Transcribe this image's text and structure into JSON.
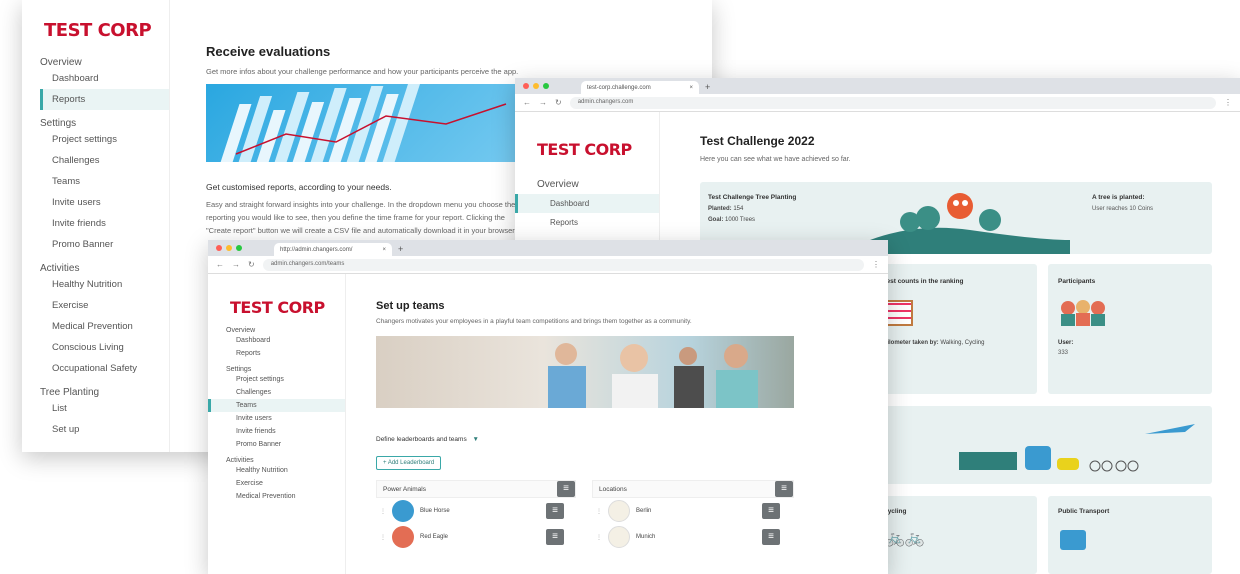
{
  "back_window": {
    "logo": "TEST CORP",
    "nav": {
      "overview": "Overview",
      "dashboard": "Dashboard",
      "reports": "Reports",
      "settings": "Settings",
      "project_settings": "Project settings",
      "challenges": "Challenges",
      "teams": "Teams",
      "invite_users": "Invite users",
      "invite_friends": "Invite friends",
      "promo_banner": "Promo Banner",
      "activities": "Activities",
      "healthy_nutrition": "Healthy Nutrition",
      "exercise": "Exercise",
      "medical_prevention": "Medical Prevention",
      "conscious_living": "Conscious Living",
      "occupational_safety": "Occupational Safety",
      "tree_planting": "Tree Planting",
      "list": "List",
      "set_up": "Set up"
    },
    "title": "Receive evaluations",
    "subtitle": "Get more infos about your challenge performance and how your participants perceive the app.",
    "section_title": "Get customised reports, according to your needs.",
    "body": "Easy and straight forward insights into your challenge. In the dropdown menu you choose the reporting you would like to see, then you define the time frame for your report. Clicking the \"Create report\" button we will create a CSV file and automatically download it in your browser."
  },
  "right_window": {
    "tab_title": "test-corp.challenge.com",
    "url": "admin.changers.com",
    "logo": "TEST CORP",
    "nav": {
      "overview": "Overview",
      "dashboard": "Dashboard",
      "reports": "Reports"
    },
    "title": "Test Challenge 2022",
    "subtitle": "Here you can see what we have achieved so far.",
    "tree_card": {
      "title": "Test Challenge Tree Planting",
      "planted_label": "Planted:",
      "planted_value": "154",
      "goal_label": "Goal:",
      "goal_value": "1000 Trees",
      "side_title": "A tree is planted:",
      "side_text": "User reaches 10 Coins"
    },
    "ranking_card": {
      "title": "Test counts in the ranking",
      "odo_label": "Kilometer taken by:",
      "odo_value": "Walking, Cycling"
    },
    "participants_card": {
      "title": "Participants",
      "users_label": "User:",
      "users_value": "333"
    },
    "cycling_card": {
      "title": "Cycling"
    },
    "transport_card": {
      "title": "Public Transport"
    }
  },
  "front_window": {
    "tab_title": "http://admin.changers.com/",
    "url": "admin.changers.com/teams",
    "logo": "TEST CORP",
    "nav": {
      "overview": "Overview",
      "dashboard": "Dashboard",
      "reports": "Reports",
      "settings": "Settings",
      "project_settings": "Project settings",
      "challenges": "Challenges",
      "teams": "Teams",
      "invite_users": "Invite users",
      "invite_friends": "Invite friends",
      "promo_banner": "Promo Banner",
      "activities": "Activities",
      "healthy_nutrition": "Healthy Nutrition",
      "exercise": "Exercise",
      "medical_prevention": "Medical Prevention"
    },
    "title": "Set up teams",
    "subtitle": "Changers motivates your employees in a playful team competitions and brings them together as a community.",
    "define_label": "Define leaderboards and teams",
    "add_button": "+ Add Leaderboard",
    "boards": [
      {
        "name": "Power Animals",
        "teams": [
          {
            "name": "Blue Horse"
          },
          {
            "name": "Red Eagle"
          }
        ]
      },
      {
        "name": "Locations",
        "teams": [
          {
            "name": "Berlin"
          },
          {
            "name": "Munich"
          }
        ]
      }
    ]
  },
  "colors": {
    "brand_red": "#c8102e",
    "teal": "#3aa8a8",
    "card_bg": "#e8f1f1"
  }
}
